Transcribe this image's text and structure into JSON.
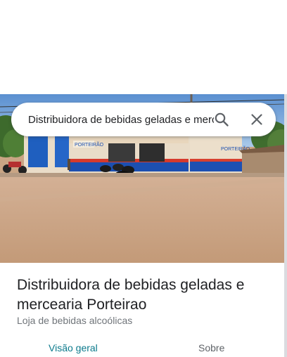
{
  "search": {
    "query": "Distribuidora de bebidas geladas e mercearia Porteirao",
    "search_icon": "search-icon",
    "close_icon": "close-icon"
  },
  "photo": {
    "storefront_sign": "PORTEIRÃO",
    "storefront_sign_side": "PORTEIRÃO"
  },
  "place": {
    "title": "Distribuidora de bebidas geladas e mercearia Porteirao",
    "category": "Loja de bebidas alcoólicas"
  },
  "tabs": [
    {
      "label": "Visão geral",
      "selected": true
    },
    {
      "label": "Sobre",
      "selected": false
    }
  ],
  "colors": {
    "accent": "#0b7a8c",
    "title": "#202124",
    "secondary": "#70757a"
  }
}
